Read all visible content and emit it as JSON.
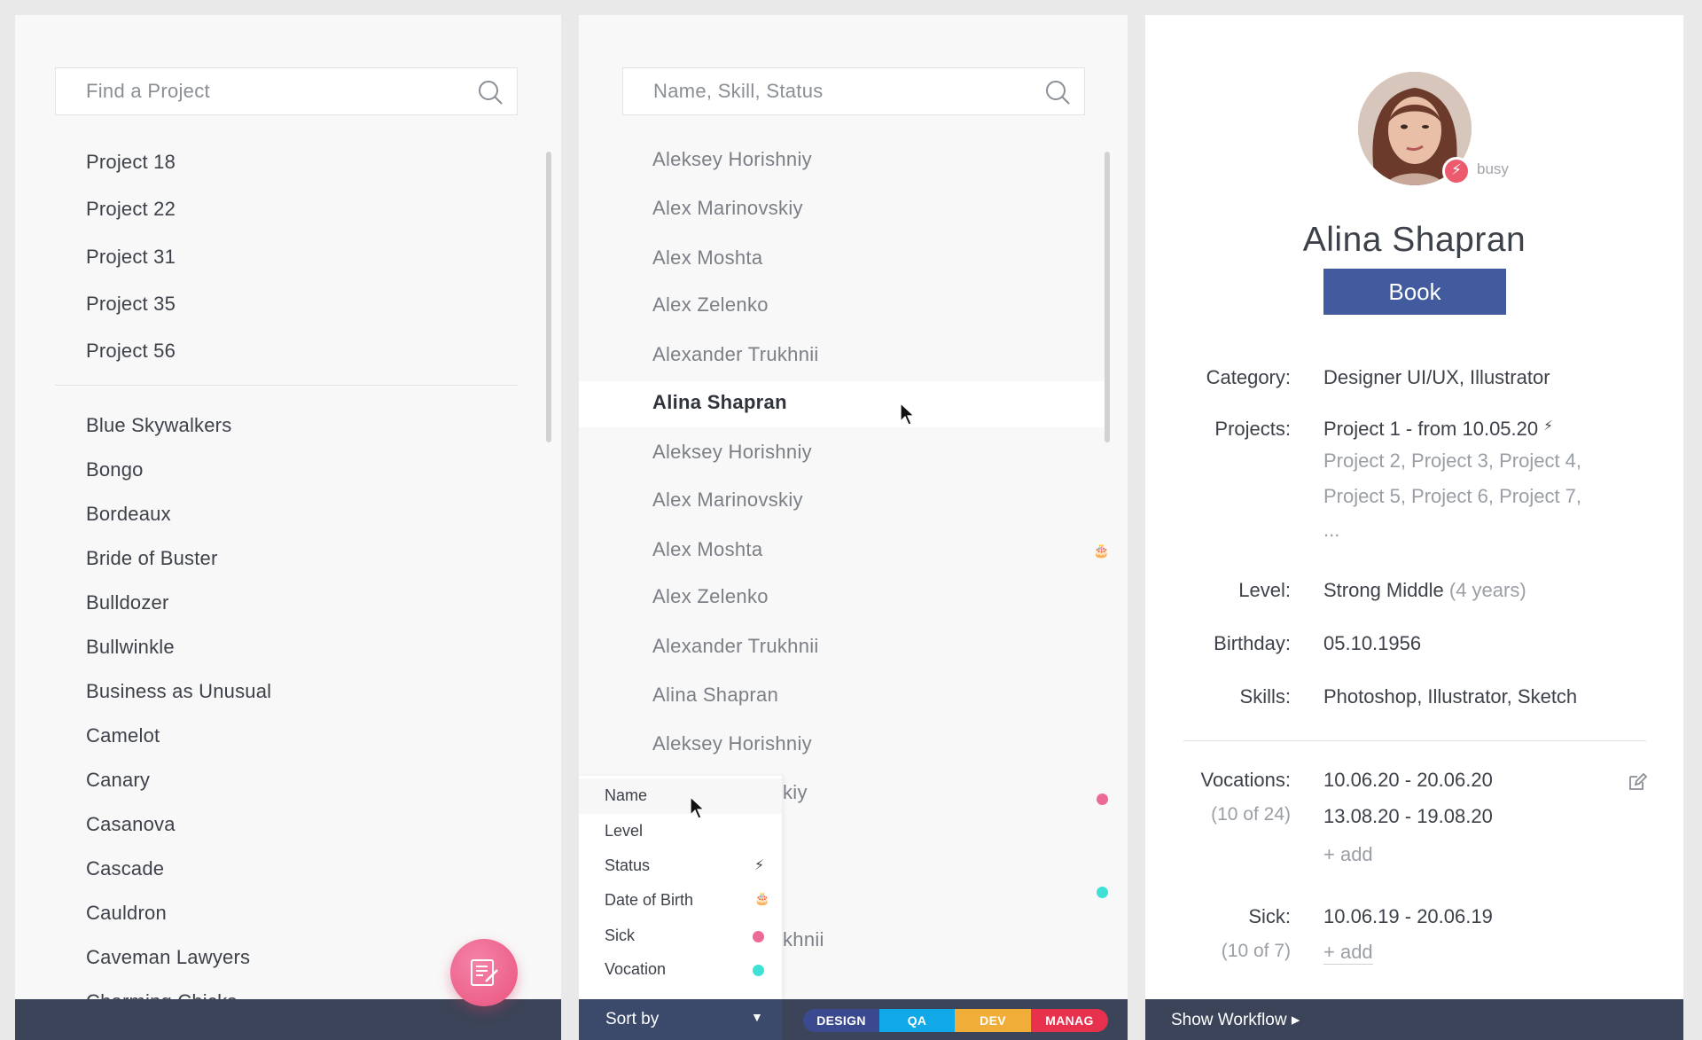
{
  "projects_panel": {
    "search_placeholder": "Find a Project",
    "my_projects": [
      "Project 18",
      "Project 22",
      "Project 31",
      "Project 35",
      "Project 56"
    ],
    "all_projects": [
      "Blue Skywalkers",
      "Bongo",
      "Bordeaux",
      "Bride of Buster",
      "Bulldozer",
      "Bullwinkle",
      "Business as Unusual",
      "Camelot",
      "Canary",
      "Casanova",
      "Cascade",
      "Cauldron",
      "Caveman Lawyers",
      "Charming Chicks"
    ],
    "fab_icon": "notes-icon"
  },
  "people_panel": {
    "search_placeholder": "Name, Skill, Status",
    "people": [
      "Aleksey Horishniy",
      "Alex Marinovskiy",
      "Alex Moshta",
      "Alex Zelenko",
      "Alexander Trukhnii",
      "Alina Shapran",
      "Aleksey Horishniy",
      "Alex Marinovskiy",
      "Alex Moshta",
      "Alex Zelenko",
      "Alexander Trukhnii",
      "Alina Shapran",
      "Aleksey Horishniy"
    ],
    "partial_people": [
      "kiy",
      "khnii"
    ],
    "selected_person": "Alina Shapran",
    "sort_menu": [
      {
        "label": "Name",
        "icon": ""
      },
      {
        "label": "Level",
        "icon": ""
      },
      {
        "label": "Status",
        "icon": "⚡"
      },
      {
        "label": "Date of Birth",
        "icon": "🎂"
      },
      {
        "label": "Sick",
        "icon": "pink-dot"
      },
      {
        "label": "Vocation",
        "icon": "cyan-dot"
      }
    ],
    "sort_by_label": "Sort by",
    "sort_arrow": "▼",
    "department_chips": [
      {
        "label": "DESIGN",
        "color": "#3b4a8f"
      },
      {
        "label": "QA",
        "color": "#11a8e8"
      },
      {
        "label": "DEV",
        "color": "#f0ad38"
      },
      {
        "label": "MANAG",
        "color": "#e8314d"
      }
    ]
  },
  "profile": {
    "status": "busy",
    "status_icon": "⚡",
    "name": "Alina Shapran",
    "book_label": "Book",
    "category_label": "Category:",
    "category_value": "Designer UI/UX, Illustrator",
    "projects_label": "Projects:",
    "current_project": "Project 1 - from 10.05.20",
    "current_project_icon": "⚡",
    "other_projects_line1": "Project 2, Project 3, Project 4,",
    "other_projects_line2": "Project 5, Project 6, Project 7,",
    "other_projects_more": "...",
    "level_label": "Level:",
    "level_value": "Strong Middle",
    "level_years": "(4 years)",
    "birthday_label": "Birthday:",
    "birthday_value": "05.10.1956",
    "skills_label": "Skills:",
    "skills_value": "Photoshop, Illustrator, Sketch",
    "vocations_label": "Vocations:",
    "vocations_count": "(10 of 24)",
    "vocations": [
      "10.06.20 - 20.06.20",
      "13.08.20 - 19.08.20"
    ],
    "vocations_add": "+ add",
    "sick_label": "Sick:",
    "sick_count": "(10 of 7)",
    "sick": [
      "10.06.19 - 20.06.19"
    ],
    "sick_add": "+ add",
    "workflow_label": "Show Workflow ▸"
  },
  "colors": {
    "footer": "#3b4458",
    "accent_blue": "#425a9e",
    "busy_red": "#ec5a6e",
    "fab_pink": "#e9547f"
  }
}
